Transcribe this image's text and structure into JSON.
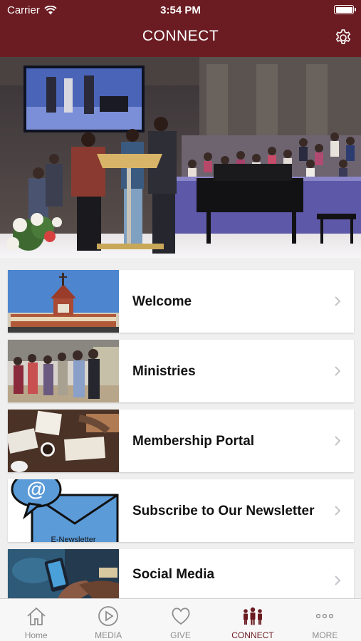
{
  "status": {
    "carrier": "Carrier",
    "time": "3:54 PM"
  },
  "header": {
    "title": "CONNECT",
    "settings_icon": "gear-icon"
  },
  "menu": [
    {
      "label": "Welcome"
    },
    {
      "label": "Ministries"
    },
    {
      "label": "Membership Portal"
    },
    {
      "label": "Subscribe to Our Newsletter"
    },
    {
      "label": "Social Media"
    }
  ],
  "newsletter_art": {
    "symbol": "@",
    "caption": "E-Newsletter"
  },
  "tabs": [
    {
      "label": "Home",
      "icon": "home-icon"
    },
    {
      "label": "MEDIA",
      "icon": "play-icon"
    },
    {
      "label": "GIVE",
      "icon": "heart-icon"
    },
    {
      "label": "CONNECT",
      "icon": "people-icon",
      "active": true
    },
    {
      "label": "MORE",
      "icon": "more-icon"
    }
  ],
  "colors": {
    "brand": "#6b1c22",
    "tab_inactive": "#8e8e8e"
  }
}
